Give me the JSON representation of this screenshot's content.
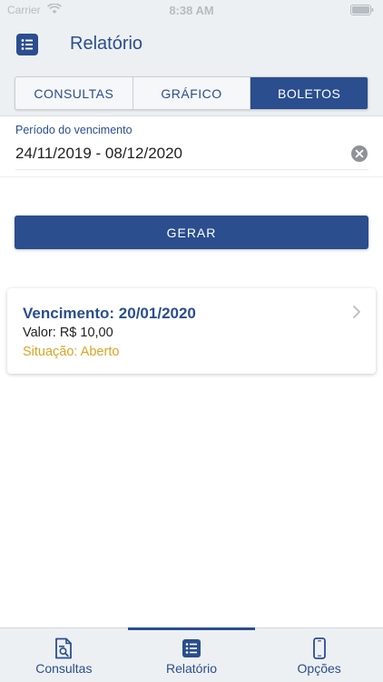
{
  "status_bar": {
    "carrier": "Carrier",
    "time": "8:38 AM"
  },
  "nav": {
    "title": "Relatório",
    "menu_icon": "list-icon"
  },
  "segments": [
    {
      "label": "CONSULTAS",
      "active": false
    },
    {
      "label": "GRÁFICO",
      "active": false
    },
    {
      "label": "BOLETOS",
      "active": true
    }
  ],
  "period": {
    "label": "Período do vencimento",
    "value": "24/11/2019 - 08/12/2020",
    "clear_icon": "clear-circle-icon"
  },
  "gerar_button": {
    "label": "GERAR"
  },
  "result": {
    "title": "Vencimento: 20/01/2020",
    "valor": "Valor: R$ 10,00",
    "situacao": "Situação: Aberto"
  },
  "tabs": [
    {
      "label": "Consultas",
      "icon": "document-search-icon",
      "active": false
    },
    {
      "label": "Relatório",
      "icon": "list-icon",
      "active": true
    },
    {
      "label": "Opções",
      "icon": "phone-icon",
      "active": false
    }
  ],
  "colors": {
    "primary": "#2a4e8e",
    "background_bar": "#edf0f2",
    "status_open": "#d8a524"
  }
}
